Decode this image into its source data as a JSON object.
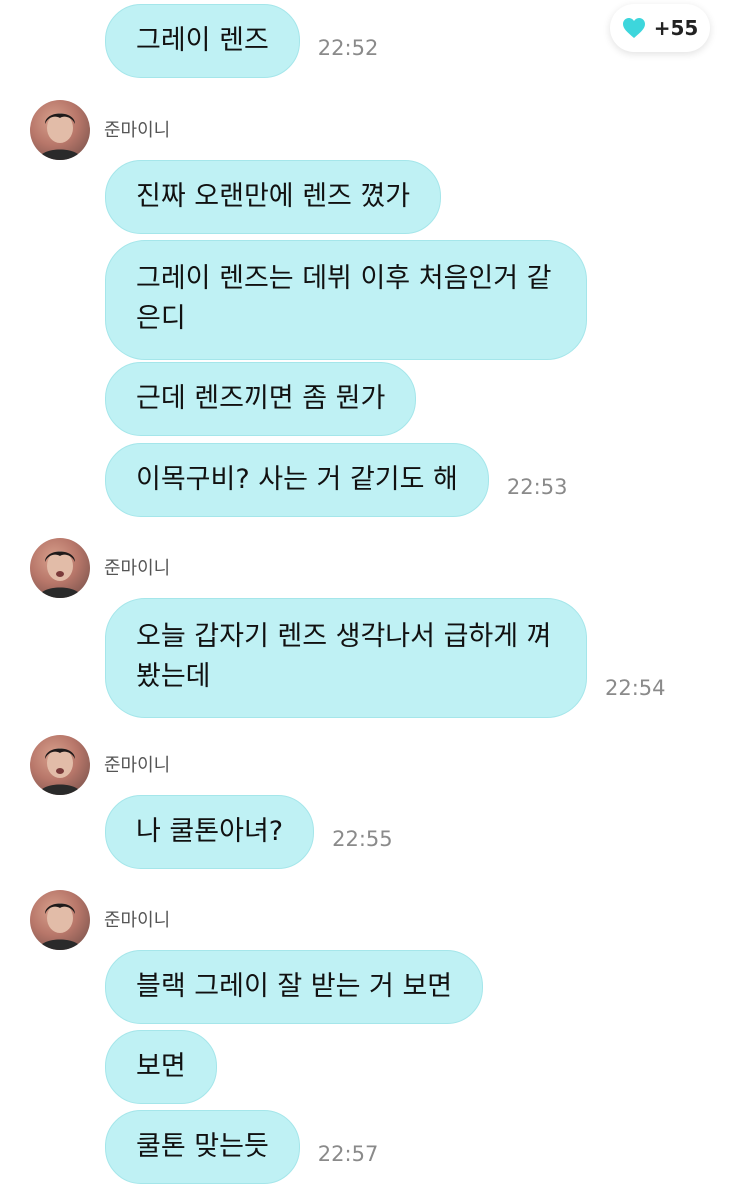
{
  "reaction": {
    "icon": "heart-icon",
    "color": "#3dd6dc",
    "count": "+55"
  },
  "groups": [
    {
      "sender": null,
      "messages": [
        {
          "text": "그레이 렌즈",
          "time": "22:52"
        }
      ]
    },
    {
      "sender": "준마이니",
      "messages": [
        {
          "text": "진짜 오랜만에 렌즈 꼈가",
          "time": ""
        },
        {
          "text": "그레이 렌즈는 데뷔 이후 처음인거 같은디",
          "time": ""
        },
        {
          "text": "근데 렌즈끼면 좀 뭔가",
          "time": ""
        },
        {
          "text": "이목구비? 사는 거 같기도 해",
          "time": "22:53"
        }
      ]
    },
    {
      "sender": "준마이니",
      "messages": [
        {
          "text": "오늘 갑자기 렌즈 생각나서 급하게 껴봤는데",
          "time": "22:54"
        }
      ]
    },
    {
      "sender": "준마이니",
      "messages": [
        {
          "text": "나 쿨톤아녀?",
          "time": "22:55"
        }
      ]
    },
    {
      "sender": "준마이니",
      "messages": [
        {
          "text": "블랙 그레이 잘 받는 거 보면",
          "time": ""
        },
        {
          "text": "보면",
          "time": ""
        },
        {
          "text": "쿨톤 맞는듯",
          "time": "22:57"
        }
      ]
    }
  ],
  "colors": {
    "bubble": "#bff1f4",
    "bubble_border": "#a5e6ea",
    "time_text": "#8a8a8a",
    "name_text": "#555555"
  }
}
